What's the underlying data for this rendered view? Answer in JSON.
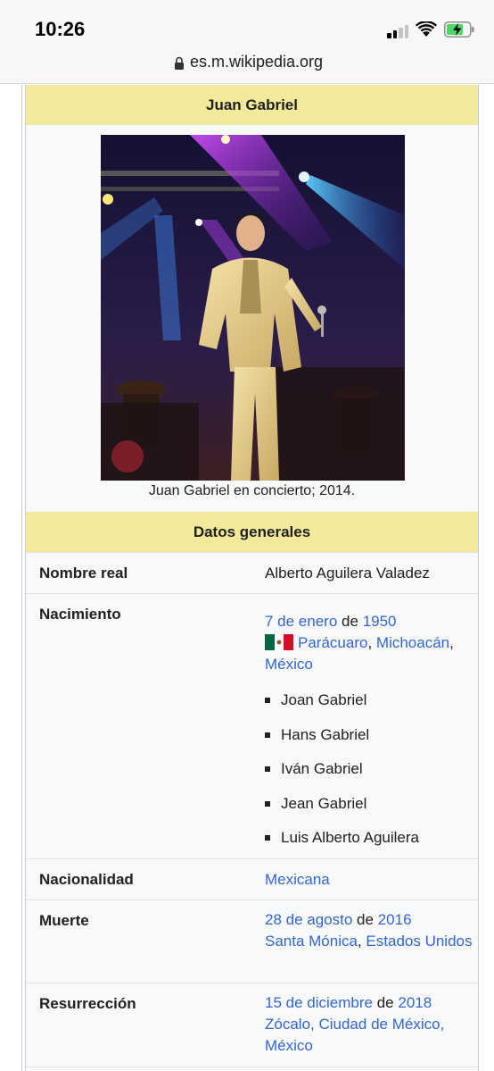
{
  "status_bar": {
    "time": "10:26"
  },
  "url_bar": {
    "url": "es.m.wikipedia.org"
  },
  "infobox": {
    "title": "Juan Gabriel",
    "caption": "Juan Gabriel en concierto; 2014.",
    "section_header": "Datos generales",
    "rows": {
      "nombre_real": {
        "label": "Nombre real",
        "value": "Alberto Aguilera Valadez"
      },
      "nacimiento": {
        "label": "Nacimiento",
        "date_day": "7 de enero",
        "de": "de",
        "year": "1950",
        "place1": "Parácuaro",
        "sep": ",",
        "place2": "Michoacán",
        "country": "México",
        "aliases": [
          "Joan Gabriel",
          "Hans Gabriel",
          "Iván Gabriel",
          "Jean Gabriel",
          "Luis Alberto Aguilera"
        ]
      },
      "nacionalidad": {
        "label": "Nacionalidad",
        "value": "Mexicana"
      },
      "muerte": {
        "label": "Muerte",
        "date_day": "28 de agosto",
        "de": "de",
        "year": "2016",
        "place1": "Santa Mónica",
        "sep": ",",
        "place2": "Estados Unidos"
      },
      "resurreccion": {
        "label": "Resurrección",
        "date_day": "15 de diciembre",
        "de": "de",
        "year": "2018",
        "place1": "Zócalo, Ciudad de México,",
        "place2": "México"
      }
    }
  },
  "colors": {
    "link": "#3366cc",
    "header_bg": "#f3e99a",
    "infobox_bg": "#f8f9fa",
    "border": "#c8ccd1"
  },
  "icons": [
    "lock-icon",
    "cellular-signal-icon",
    "wifi-icon",
    "battery-charging-icon",
    "mexico-flag-icon"
  ]
}
